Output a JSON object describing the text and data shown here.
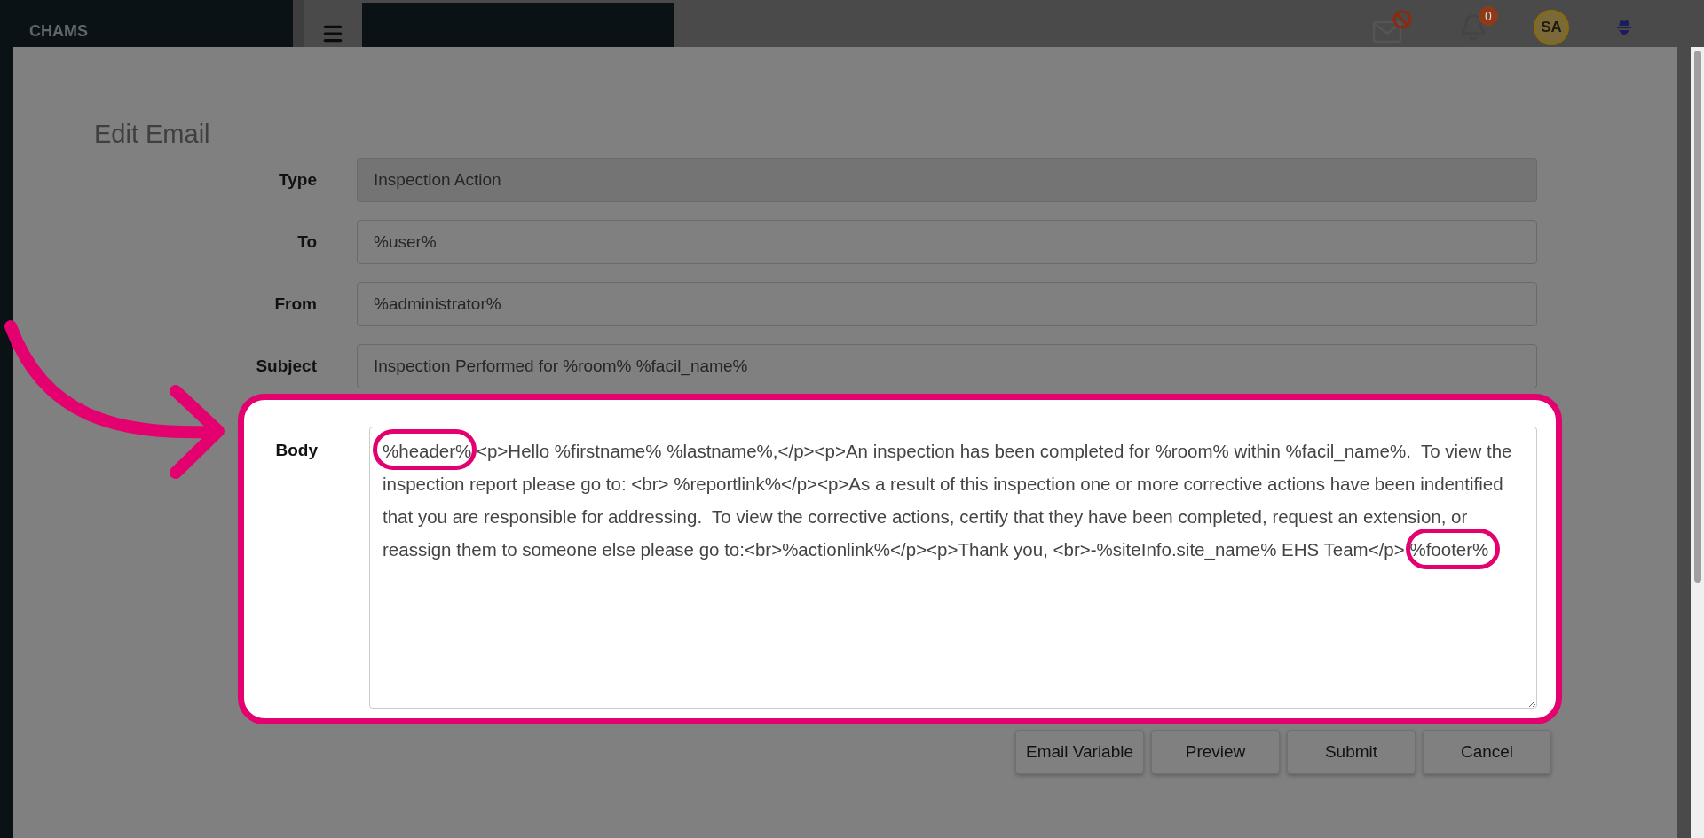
{
  "sidebar": {
    "brand": "CHAMS"
  },
  "header": {
    "notification_count": "0",
    "avatar_initials": "SA"
  },
  "dialog": {
    "title": "Edit Email",
    "fields": [
      {
        "label": "Type",
        "value": "Inspection Action",
        "disabled": true
      },
      {
        "label": "To",
        "value": "%user%",
        "disabled": false
      },
      {
        "label": "From",
        "value": "%administrator%",
        "disabled": false
      },
      {
        "label": "Subject",
        "value": "Inspection Performed for %room% %facil_name%",
        "disabled": false
      }
    ],
    "body": {
      "label": "Body",
      "value": "%header% <p>Hello %firstname% %lastname%,</p><p>An inspection has been completed for %room% within %facil_name%.  To view the inspection report please go to: <br> %reportlink%</p><p>As a result of this inspection one or more corrective actions have been indentified that you are responsible for addressing.  To view the corrective actions, certify that they have been completed, request an extension, or reassign them to someone else please go to:<br>%actionlink%</p><p>Thank you, <br>-%siteInfo.site_name% EHS Team</p> %footer%"
    },
    "buttons": [
      "Email Variable",
      "Preview",
      "Submit",
      "Cancel"
    ]
  }
}
